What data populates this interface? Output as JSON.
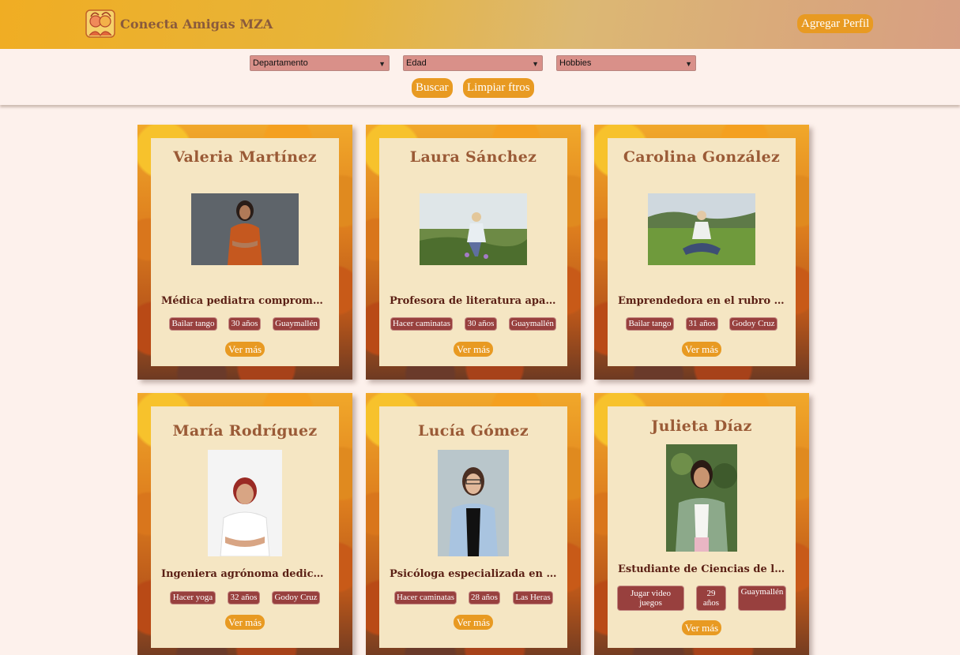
{
  "brand": {
    "title": "Conecta Amigas MZA"
  },
  "header": {
    "add_profile_label": "Agregar Perfil"
  },
  "filters": {
    "department": "Departamento",
    "age": "Edad",
    "hobbies": "Hobbies",
    "search_label": "Buscar",
    "clear_label": "Limpiar ftros"
  },
  "profiles": [
    {
      "name": "Valeria Martínez",
      "description": "Médica pediatra comprometida c…",
      "hobby": "Bailar tango",
      "age": "30 años",
      "location": "Guaymallén",
      "more": "Ver más"
    },
    {
      "name": "Laura Sánchez",
      "description": "Profesora de literatura apasionad…",
      "hobby": "Hacer caminatas",
      "age": "30 años",
      "location": "Guaymallén",
      "more": "Ver más"
    },
    {
      "name": "Carolina González",
      "description": "Emprendedora en el rubro de la …",
      "hobby": "Bailar tango",
      "age": "31 años",
      "location": "Godoy Cruz",
      "more": "Ver más"
    },
    {
      "name": "María Rodríguez",
      "description": "Ingeniera agrónoma dedicada a la…",
      "hobby": "Hacer yoga",
      "age": "32 años",
      "location": "Godoy Cruz",
      "more": "Ver más"
    },
    {
      "name": "Lucía Gómez",
      "description": "Psicóloga especializada en terapia…",
      "hobby": "Hacer caminatas",
      "age": "28 años",
      "location": "Las Heras",
      "more": "Ver más"
    },
    {
      "name": "Julieta Díaz",
      "description": "Estudiante de Ciencias de la Com…",
      "hobby_line1": "Jugar video",
      "hobby_line2": "juegos",
      "age_line1": "29",
      "age_line2": "años",
      "location": "Guaymallén",
      "more": "Ver más"
    }
  ],
  "colors": {
    "accent": "#e89a22",
    "badge": "#98403e",
    "card_bg": "#f5e6c3",
    "page_bg": "#fdf1ec"
  }
}
